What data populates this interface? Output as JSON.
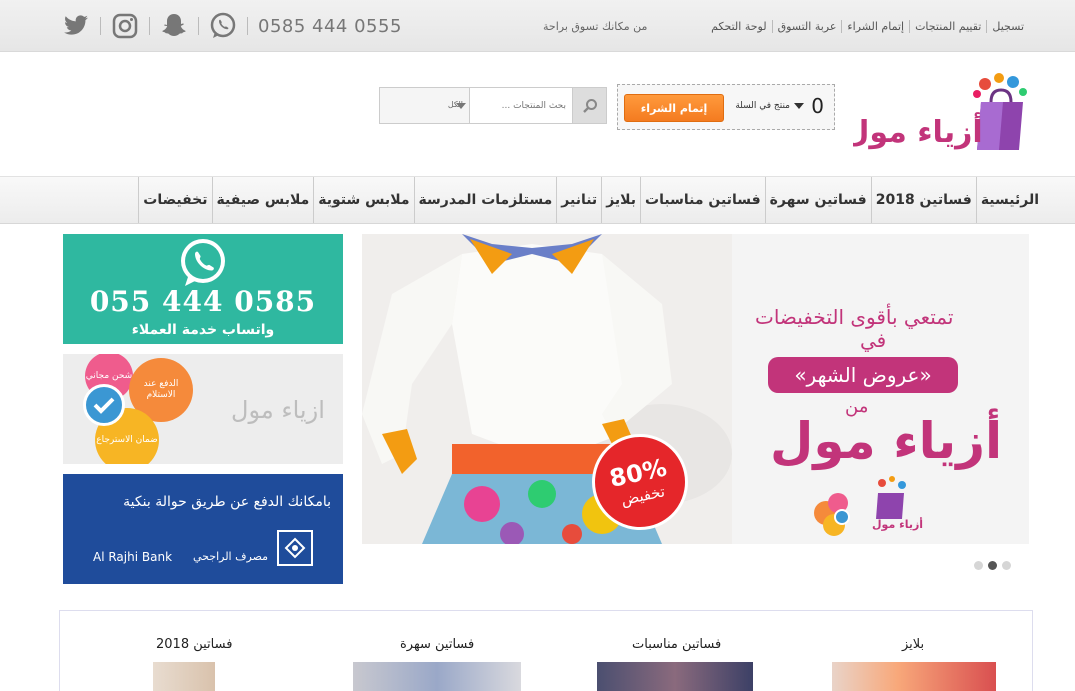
{
  "topbar": {
    "phone": "0585 444 0555",
    "tagline": "من مكانك تسوق براحة",
    "links": [
      "تسجيل",
      "تقييم المنتجات",
      "إتمام الشراء",
      "عربة التسوق",
      "لوحة التحكم"
    ]
  },
  "header": {
    "cart": {
      "count": "0",
      "label": "منتج في السلة",
      "checkout": "إتمام الشراء"
    },
    "search": {
      "placeholder": "بحث المنتجات ...",
      "category": "الكل"
    }
  },
  "nav": [
    "الرئيسية",
    "فساتين 2018",
    "فساتين سهرة",
    "فساتين مناسبات",
    "بلايز",
    "تنانير",
    "مستلزمات المدرسة",
    "ملابس شتوية",
    "ملابس صيفية",
    "تخفيضات"
  ],
  "slider": {
    "line1": "تمتعي بأقوى التخفيضات",
    "line2": "في",
    "offer": "«عروض الشهر»",
    "line3": "من",
    "brand": "أزياء مول",
    "discount_pct": "80%",
    "discount_label": "تخفيض",
    "mini_brand": "أزياء مول",
    "dots": 3,
    "active_dot": 1
  },
  "sidebar": {
    "whatsapp": {
      "phone": "055 444 0585",
      "label": "واتساب خدمة العملاء"
    },
    "features": {
      "brand": "ازياء مول",
      "shipping": "شحن مجاني",
      "payment": "الدفع عند الاستلام",
      "return": "ضمان الاسترجاع"
    },
    "bank": {
      "text": "بامكانك الدفع عن طريق حوالة بنكية",
      "name_en": "Al Rajhi Bank",
      "name_ar": "مصرف الراجحي"
    }
  },
  "categories": [
    "بلايز",
    "فساتين مناسبات",
    "فساتين سهرة",
    "فساتين 2018"
  ],
  "colors": {
    "brand_pink": "#c2347a",
    "checkout_orange": "#f47b20",
    "whatsapp_teal": "#2fb8a0",
    "bank_blue": "#1f4c9b"
  }
}
